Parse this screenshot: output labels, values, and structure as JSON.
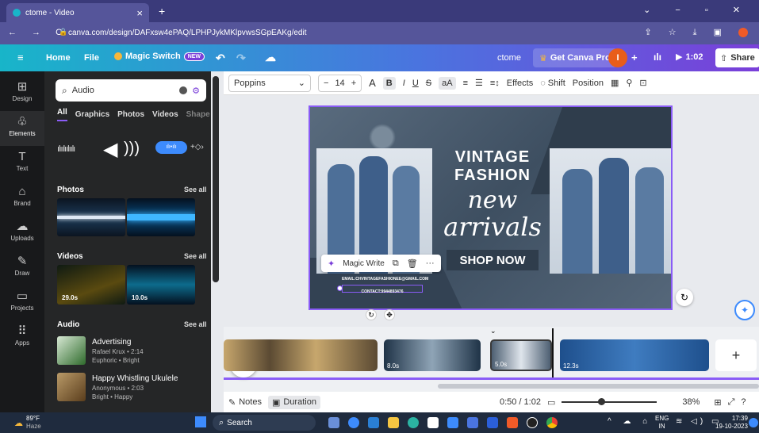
{
  "browser": {
    "tab_title": "ctome - Video",
    "close_label": "×",
    "new_tab_label": "+",
    "url": "canva.com/design/DAFxsw4ePAQ/LPHPJykMKlpvwsSGpEAKg/edit"
  },
  "header": {
    "home": "Home",
    "file": "File",
    "magic_switch": "Magic Switch",
    "new_badge": "NEW",
    "design_name": "ctome",
    "get_pro": "Get Canva Pro",
    "avatar_initial": "I",
    "play_time": "1:02",
    "share": "Share"
  },
  "toolbar": {
    "font": "Poppins",
    "size": "14",
    "minus": "−",
    "plus": "+",
    "effects": "Effects",
    "shift": "Shift",
    "position": "Position"
  },
  "rail": [
    {
      "label": "Design",
      "icon": "layout-icon",
      "glyph": "⊞"
    },
    {
      "label": "Elements",
      "icon": "elements-icon",
      "glyph": "♧"
    },
    {
      "label": "Text",
      "icon": "text-icon",
      "glyph": "T"
    },
    {
      "label": "Brand",
      "icon": "brand-icon",
      "glyph": "⌂"
    },
    {
      "label": "Uploads",
      "icon": "upload-icon",
      "glyph": "☁"
    },
    {
      "label": "Draw",
      "icon": "draw-icon",
      "glyph": "✎"
    },
    {
      "label": "Projects",
      "icon": "folder-icon",
      "glyph": "▭"
    },
    {
      "label": "Apps",
      "icon": "apps-icon",
      "glyph": "⠿"
    }
  ],
  "panel": {
    "search_value": "Audio",
    "tabs": [
      "All",
      "Graphics",
      "Photos",
      "Videos",
      "Shape"
    ],
    "photos_title": "Photos",
    "videos_title": "Videos",
    "audio_title": "Audio",
    "see_all": "See all",
    "video_durations": [
      "29.0s",
      "10.0s"
    ],
    "audio_items": [
      {
        "title": "Advertising",
        "artist": "Rafael Krux • 2:14",
        "tags": "Euphoric • Bright"
      },
      {
        "title": "Happy Whistling Ukulele",
        "artist": "Anonymous • 2:03",
        "tags": "Bright • Happy"
      }
    ]
  },
  "canvas": {
    "line1": "VINTAGE",
    "line2": "FASHION",
    "script1": "new",
    "script2": "arrivals",
    "cta": "SHOP NOW",
    "email": "EMAIL:CHVINTAGEFASHIONEE@GMAIL.COM",
    "contact": "CONTACT:9944893476",
    "magic_write": "Magic Write"
  },
  "timeline": {
    "clips": [
      {
        "label": "",
        "duration": ""
      },
      {
        "label": "",
        "duration": "8.0s"
      },
      {
        "label": "",
        "duration": "5.0s"
      },
      {
        "label": "",
        "duration": "12.3s"
      }
    ],
    "add": "+"
  },
  "bottombar": {
    "notes": "Notes",
    "duration": "Duration",
    "time": "0:50 / 1:02",
    "zoom": "38%",
    "zoom_fraction": 0.38
  },
  "taskbar": {
    "weather_temp": "89°F",
    "weather_desc": "Haze",
    "search": "Search",
    "lang": "ENG",
    "region": "IN",
    "time": "17:39",
    "date": "19-10-2023"
  }
}
